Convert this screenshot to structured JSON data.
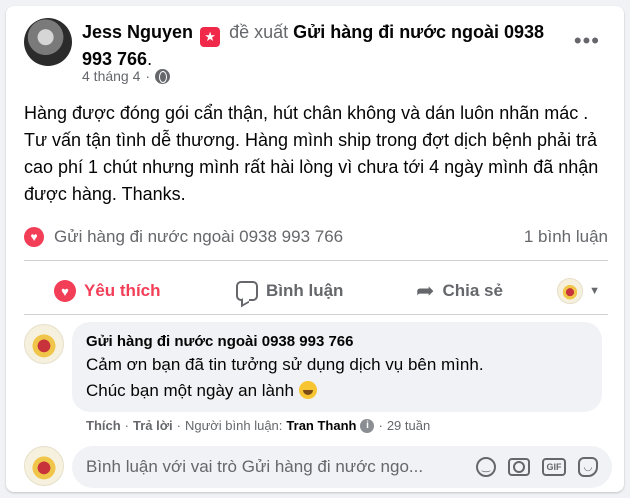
{
  "post": {
    "author": "Jess Nguyen",
    "verb": "đề xuất",
    "page_name": "Gửi hàng đi nước ngoài 0938 993 766",
    "page_suffix": ".",
    "date": "4 tháng 4",
    "date_separator": "·",
    "more_label": "•••",
    "text": "Hàng được đóng gói cẩn thận, hút  chân không và dán luôn nhãn mác . Tư vấn tận tình dễ thương. Hàng mình ship trong đợt dịch bệnh phải trả cao phí 1 chút nhưng mình rất hài lòng vì chưa tới 4 ngày mình đã nhận được hàng. Thanks."
  },
  "reactions": {
    "names": "Gửi hàng đi nước ngoài 0938 993 766",
    "comment_count": "1 bình luận"
  },
  "actions": {
    "like": "Yêu thích",
    "comment": "Bình luận",
    "share": "Chia sẻ"
  },
  "comment": {
    "name": "Gửi hàng đi nước ngoài 0938 993 766",
    "line1": "Cảm ơn bạn đã tin tưởng sử dụng dịch vụ bên mình.",
    "line2": "Chúc bạn một ngày an lành",
    "like": "Thích",
    "reply": "Trả lời",
    "commenter_label": "Người bình luận:",
    "commenter": "Tran Thanh",
    "time": "29 tuần",
    "sep": "·"
  },
  "composer": {
    "placeholder": "Bình luận với vai trò Gửi hàng đi nước ngo..."
  },
  "colors": {
    "accent_like": "#f33e58",
    "muted": "#65676b",
    "bubble": "#f0f2f5"
  }
}
